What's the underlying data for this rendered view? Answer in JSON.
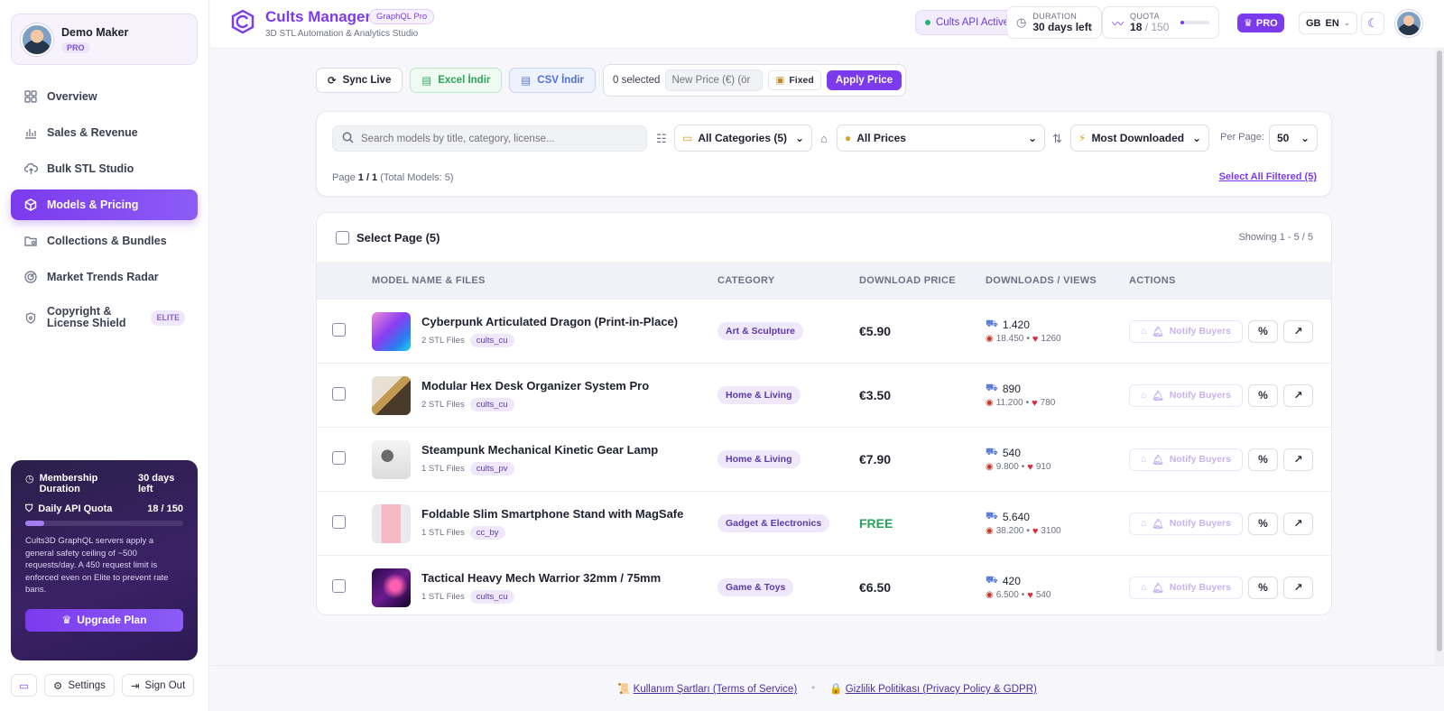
{
  "sidebar": {
    "user": {
      "name": "Demo Maker",
      "badge": "PRO"
    },
    "items": [
      {
        "label": "Overview",
        "icon": "grid-icon"
      },
      {
        "label": "Sales & Revenue",
        "icon": "bar-chart-icon"
      },
      {
        "label": "Bulk STL Studio",
        "icon": "cloud-upload-icon"
      },
      {
        "label": "Models & Pricing",
        "icon": "cube-icon",
        "active": true
      },
      {
        "label": "Collections & Bundles",
        "icon": "folder-icon"
      },
      {
        "label": "Market Trends Radar",
        "icon": "radar-icon"
      },
      {
        "label": "Copyright & License Shield",
        "icon": "shield-icon",
        "badge": "ELITE"
      }
    ],
    "membership": {
      "duration_label": "Membership Duration",
      "duration_value": "30 days left",
      "quota_label": "Daily API Quota",
      "quota_value": "18 / 150",
      "quota_fraction": 0.12,
      "description": "Cults3D GraphQL servers apply a general safety ceiling of ~500 requests/day. A 450 request limit is enforced even on Elite to prevent rate bans.",
      "upgrade_label": "Upgrade Plan"
    },
    "footer": {
      "settings": "Settings",
      "signout": "Sign Out"
    }
  },
  "header": {
    "brand": "Cults Manager",
    "brand_badge": "GraphQL Pro",
    "subtitle": "3D STL Automation & Analytics Studio",
    "api_status": "Cults API Active",
    "duration_label": "DURATION",
    "duration_value": "30 days left",
    "quota_label": "QUOTA",
    "quota_used": "18",
    "quota_total": "/ 150",
    "pro": "PRO",
    "lang_flag": "GB",
    "lang": "EN"
  },
  "toolbar": {
    "sync": "Sync Live",
    "excel": "Excel İndir",
    "csv": "CSV İndir",
    "selected": "0 selected",
    "new_price_placeholder": "New Price (€) (ör",
    "fixed": "Fixed",
    "apply": "Apply Price"
  },
  "filters": {
    "search_placeholder": "Search models by title, category, license...",
    "category": "All Categories (5)",
    "price": "All Prices",
    "sort": "Most Downloaded",
    "per_page_label": "Per Page:",
    "per_page": "50",
    "page_prefix": "Page",
    "page_current": "1 / 1",
    "page_total": "(Total Models: 5)",
    "select_all": "Select All Filtered (5)"
  },
  "table": {
    "select_page": "Select Page (5)",
    "showing": "Showing 1 - 5 / 5",
    "columns": [
      "MODEL NAME & FILES",
      "CATEGORY",
      "DOWNLOAD PRICE",
      "DOWNLOADS / VIEWS",
      "ACTIONS"
    ],
    "notify_label": "Notify Buyers",
    "rows": [
      {
        "name": "Cyberpunk Articulated Dragon (Print-in-Place)",
        "files": "2 STL Files",
        "license": "cults_cu",
        "category": "Art & Sculpture",
        "price": "€5.90",
        "downloads": "1.420",
        "views": "18.450",
        "likes": "1260",
        "thumb": "purple-gradient"
      },
      {
        "name": "Modular Hex Desk Organizer System Pro",
        "files": "2 STL Files",
        "license": "cults_cu",
        "category": "Home & Living",
        "price": "€3.50",
        "downloads": "890",
        "views": "11.200",
        "likes": "780",
        "thumb": "interior"
      },
      {
        "name": "Steampunk Mechanical Kinetic Gear Lamp",
        "files": "1 STL Files",
        "license": "cults_pv",
        "category": "Home & Living",
        "price": "€7.90",
        "downloads": "540",
        "views": "9.800",
        "likes": "910",
        "thumb": "lamp"
      },
      {
        "name": "Foldable Slim Smartphone Stand with MagSafe",
        "files": "1 STL Files",
        "license": "cc_by",
        "category": "Gadget & Electronics",
        "price": "FREE",
        "downloads": "5.640",
        "views": "38.200",
        "likes": "3100",
        "thumb": "phone"
      },
      {
        "name": "Tactical Heavy Mech Warrior 32mm / 75mm",
        "files": "1 STL Files",
        "license": "cults_cu",
        "category": "Game & Toys",
        "price": "€6.50",
        "downloads": "420",
        "views": "6.500",
        "likes": "540",
        "thumb": "nebula"
      }
    ]
  },
  "footer": {
    "terms_icon": "📜",
    "terms": "Kullanım Şartları (Terms of Service)",
    "privacy_icon": "🔒",
    "privacy": "Gizlilik Politikası (Privacy Policy & GDPR)",
    "separator": "•"
  }
}
